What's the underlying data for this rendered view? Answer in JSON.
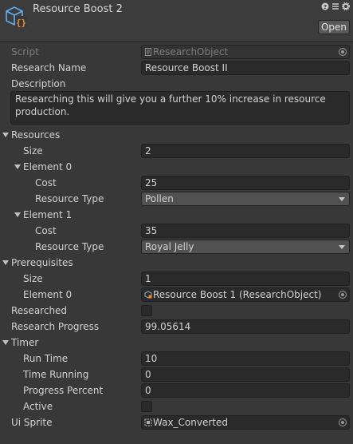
{
  "header": {
    "title": "Resource Boost 2",
    "open_label": "Open",
    "icons": [
      "help-icon",
      "preset-icon",
      "settings-icon"
    ]
  },
  "fields": {
    "script": {
      "label": "Script",
      "value": "ResearchObject"
    },
    "research_name": {
      "label": "Research Name",
      "value": "Resource Boost II"
    },
    "description": {
      "label": "Description",
      "value": "Researching this will give you a further 10% increase in resource production."
    },
    "resources": {
      "label": "Resources",
      "size_label": "Size",
      "size": "2",
      "elements": [
        {
          "label": "Element 0",
          "cost_label": "Cost",
          "cost": "25",
          "type_label": "Resource Type",
          "type": "Pollen"
        },
        {
          "label": "Element 1",
          "cost_label": "Cost",
          "cost": "35",
          "type_label": "Resource Type",
          "type": "Royal Jelly"
        }
      ]
    },
    "prerequisites": {
      "label": "Prerequisites",
      "size_label": "Size",
      "size": "1",
      "element0_label": "Element 0",
      "element0": "Resource Boost 1 (ResearchObject)"
    },
    "researched": {
      "label": "Researched",
      "checked": false
    },
    "research_progress": {
      "label": "Research Progress",
      "value": "99.05614"
    },
    "timer": {
      "label": "Timer",
      "run_time_label": "Run Time",
      "run_time": "10",
      "time_running_label": "Time Running",
      "time_running": "0",
      "progress_percent_label": "Progress Percent",
      "progress_percent": "0",
      "active_label": "Active",
      "active": false
    },
    "ui_sprite": {
      "label": "Ui Sprite",
      "value": "Wax_Converted"
    }
  },
  "colors": {
    "background": "#383838",
    "field": "#2a2a2a",
    "icon_accent": "#f08a2c",
    "icon_outline": "#5fb1f0"
  }
}
